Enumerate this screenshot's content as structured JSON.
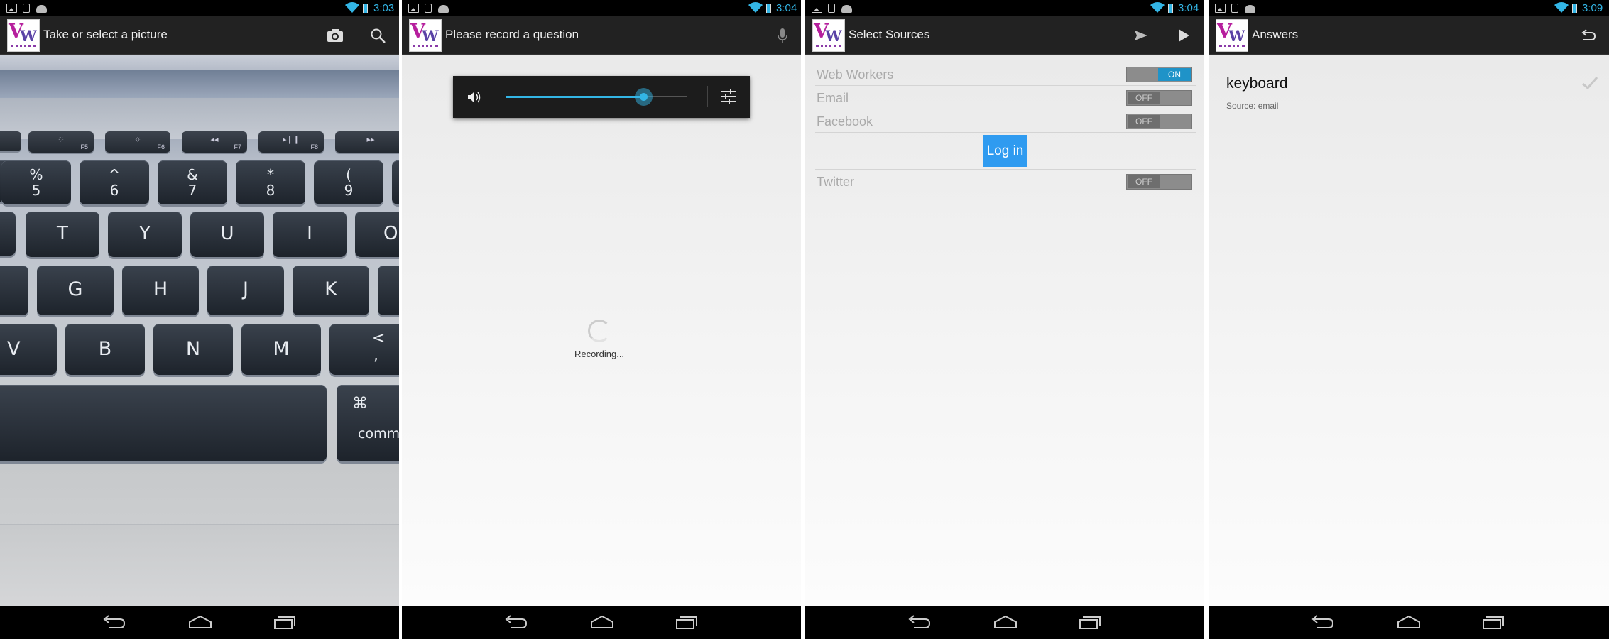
{
  "screens": [
    {
      "id": "camera",
      "status_time": "3:03",
      "title": "Take or select a picture",
      "actions": [
        "camera-icon",
        "search-icon"
      ]
    },
    {
      "id": "record",
      "status_time": "3:04",
      "title": "Please record a question",
      "actions": [
        "microphone-icon"
      ],
      "volume_level": 0.76,
      "recording_text": "Recording..."
    },
    {
      "id": "sources",
      "status_time": "3:04",
      "title": "Select Sources",
      "actions": [
        "send-icon",
        "play-icon"
      ],
      "sources": [
        {
          "label": "Web Workers",
          "toggle": "ON",
          "state": "on"
        },
        {
          "label": "Email",
          "toggle": "OFF",
          "state": "off"
        },
        {
          "label": "Facebook",
          "toggle": "OFF",
          "state": "off"
        },
        {
          "label": "Twitter",
          "toggle": "OFF",
          "state": "off"
        }
      ],
      "login_label": "Log in"
    },
    {
      "id": "answers",
      "status_time": "3:09",
      "title": "Answers",
      "actions": [
        "undo-icon"
      ],
      "answers": [
        {
          "text": "keyboard",
          "source": "Source: email",
          "status_icon": "checkmark-icon"
        }
      ]
    }
  ],
  "keyboard_photo": {
    "fn_row": [
      "F5",
      "F6",
      "F7",
      "F8"
    ],
    "number_row": [
      [
        "%",
        "5"
      ],
      [
        "^",
        "6"
      ],
      [
        "&",
        "7"
      ],
      [
        "*",
        "8"
      ],
      [
        "(",
        "9"
      ]
    ],
    "letter_row_1": [
      "T",
      "Y",
      "U",
      "I",
      "O"
    ],
    "letter_row_2": [
      "G",
      "H",
      "J",
      "K"
    ],
    "letter_row_3": [
      "V",
      "B",
      "N",
      "M"
    ],
    "punct_key": [
      "<",
      ","
    ],
    "cmd_key": [
      "⌘",
      "comm"
    ]
  },
  "colors": {
    "accent": "#33b5e5",
    "login_button": "#2f9bf0",
    "logo_magenta": "#b61f9d",
    "logo_purple": "#5a42a6"
  }
}
